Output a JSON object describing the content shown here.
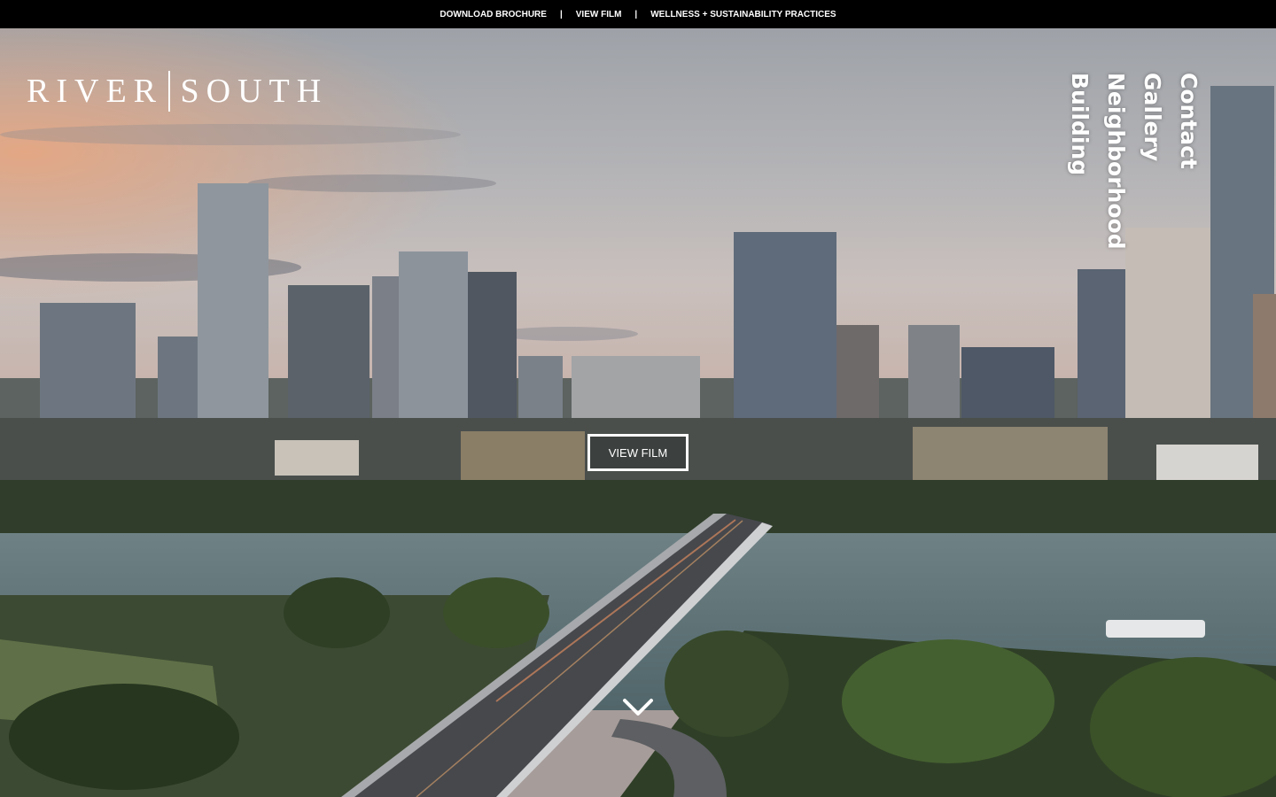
{
  "topbar": {
    "links": [
      "DOWNLOAD BROCHURE",
      "VIEW FILM",
      "WELLNESS + SUSTAINABILITY PRACTICES"
    ],
    "separator": "|"
  },
  "logo": {
    "left": "RIVER",
    "right": "SOUTH"
  },
  "nav": [
    "Contact",
    "Gallery",
    "Neighborhood",
    "Building"
  ],
  "hero": {
    "button_label": "VIEW FILM",
    "scroll_icon": "chevron-down-icon"
  },
  "colors": {
    "topbar_bg": "#000000",
    "text": "#ffffff",
    "water": "#5f7479"
  }
}
